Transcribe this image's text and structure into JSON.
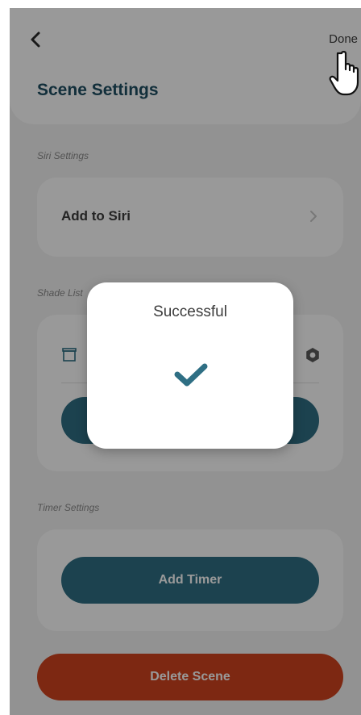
{
  "header": {
    "done_label": "Done",
    "title": "Scene Settings"
  },
  "siri": {
    "section_label": "Siri Settings",
    "add_label": "Add to Siri"
  },
  "shades": {
    "section_label": "Shade List",
    "button_label": ""
  },
  "timer": {
    "section_label": "Timer Settings",
    "add_label": "Add Timer"
  },
  "delete_label": "Delete Scene",
  "modal": {
    "title": "Successful",
    "icon": "checkmark-icon"
  },
  "colors": {
    "primary": "#2f6f84",
    "danger": "#d0431e",
    "title": "#1f4f63"
  }
}
